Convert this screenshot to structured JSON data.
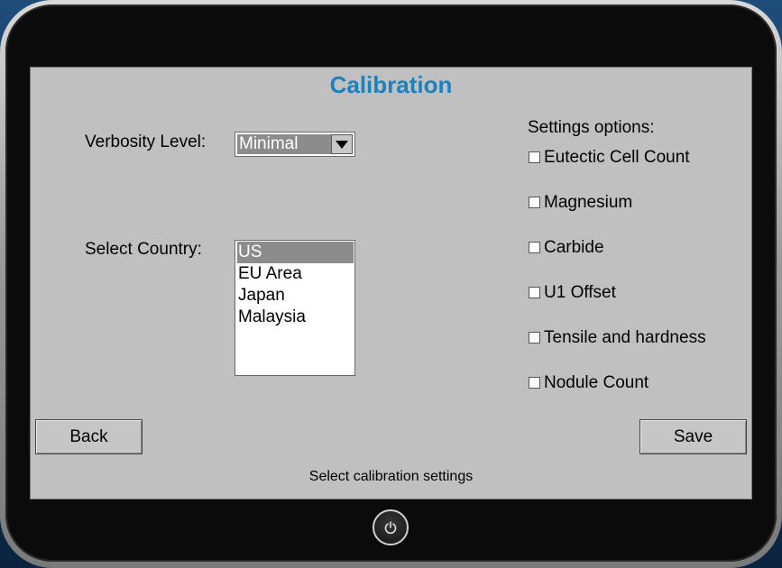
{
  "screen": {
    "title": "Calibration",
    "status_text": "Select calibration settings"
  },
  "verbosity": {
    "label": "Verbosity Level:",
    "selected": "Minimal"
  },
  "country": {
    "label": "Select Country:",
    "options": [
      "US",
      "EU Area",
      "Japan",
      "Malaysia"
    ],
    "selected": "US"
  },
  "settings": {
    "header": "Settings options:",
    "options": [
      {
        "label": "Eutectic Cell Count",
        "checked": false
      },
      {
        "label": "Magnesium",
        "checked": false
      },
      {
        "label": "Carbide",
        "checked": false
      },
      {
        "label": "U1 Offset",
        "checked": false
      },
      {
        "label": "Tensile and hardness",
        "checked": false
      },
      {
        "label": "Nodule Count",
        "checked": false
      }
    ]
  },
  "buttons": {
    "back": "Back",
    "save": "Save"
  },
  "icons": {
    "power": "power-icon",
    "dropdown": "chevron-down-icon"
  },
  "colors": {
    "title": "#1a82c0",
    "screen_bg": "#c0c0c0",
    "selection": "#8c8c8c"
  }
}
